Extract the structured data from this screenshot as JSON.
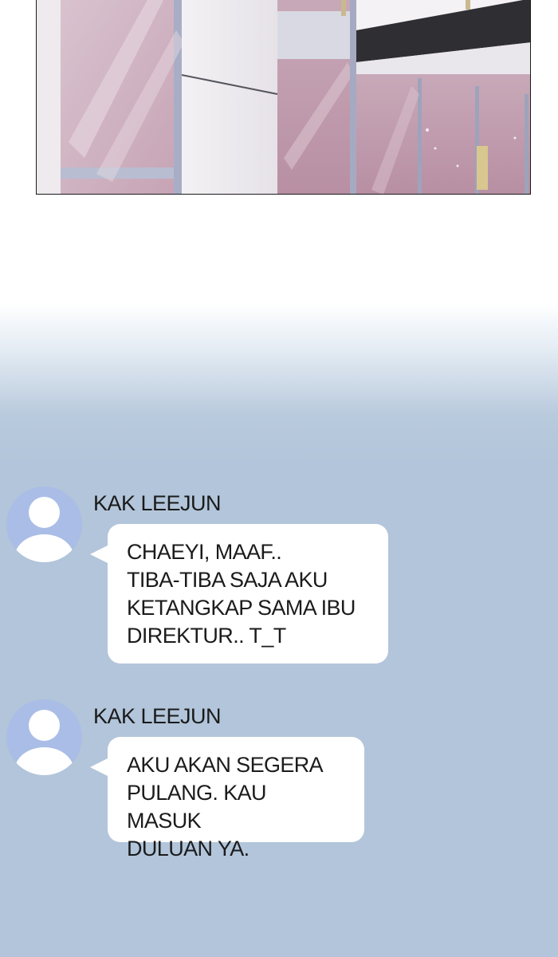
{
  "colors": {
    "background_top": "#ffffff",
    "background_chat": "#b2c5da",
    "avatar": "#a9bde6",
    "bubble": "#ffffff",
    "text": "#1b1b1b"
  },
  "panel": {
    "icon": "building-interior-illustration"
  },
  "messages": [
    {
      "sender": "KAK LEEJUN",
      "avatar_icon": "user-avatar-icon",
      "text": "CHAEYI, MAAF..\nTIBA-TIBA SAJA AKU\nKETANGKAP SAMA IBU\nDIREKTUR.. T_T"
    },
    {
      "sender": "KAK LEEJUN",
      "avatar_icon": "user-avatar-icon",
      "text": "AKU AKAN SEGERA\nPULANG. KAU MASUK\nDULUAN YA."
    }
  ]
}
